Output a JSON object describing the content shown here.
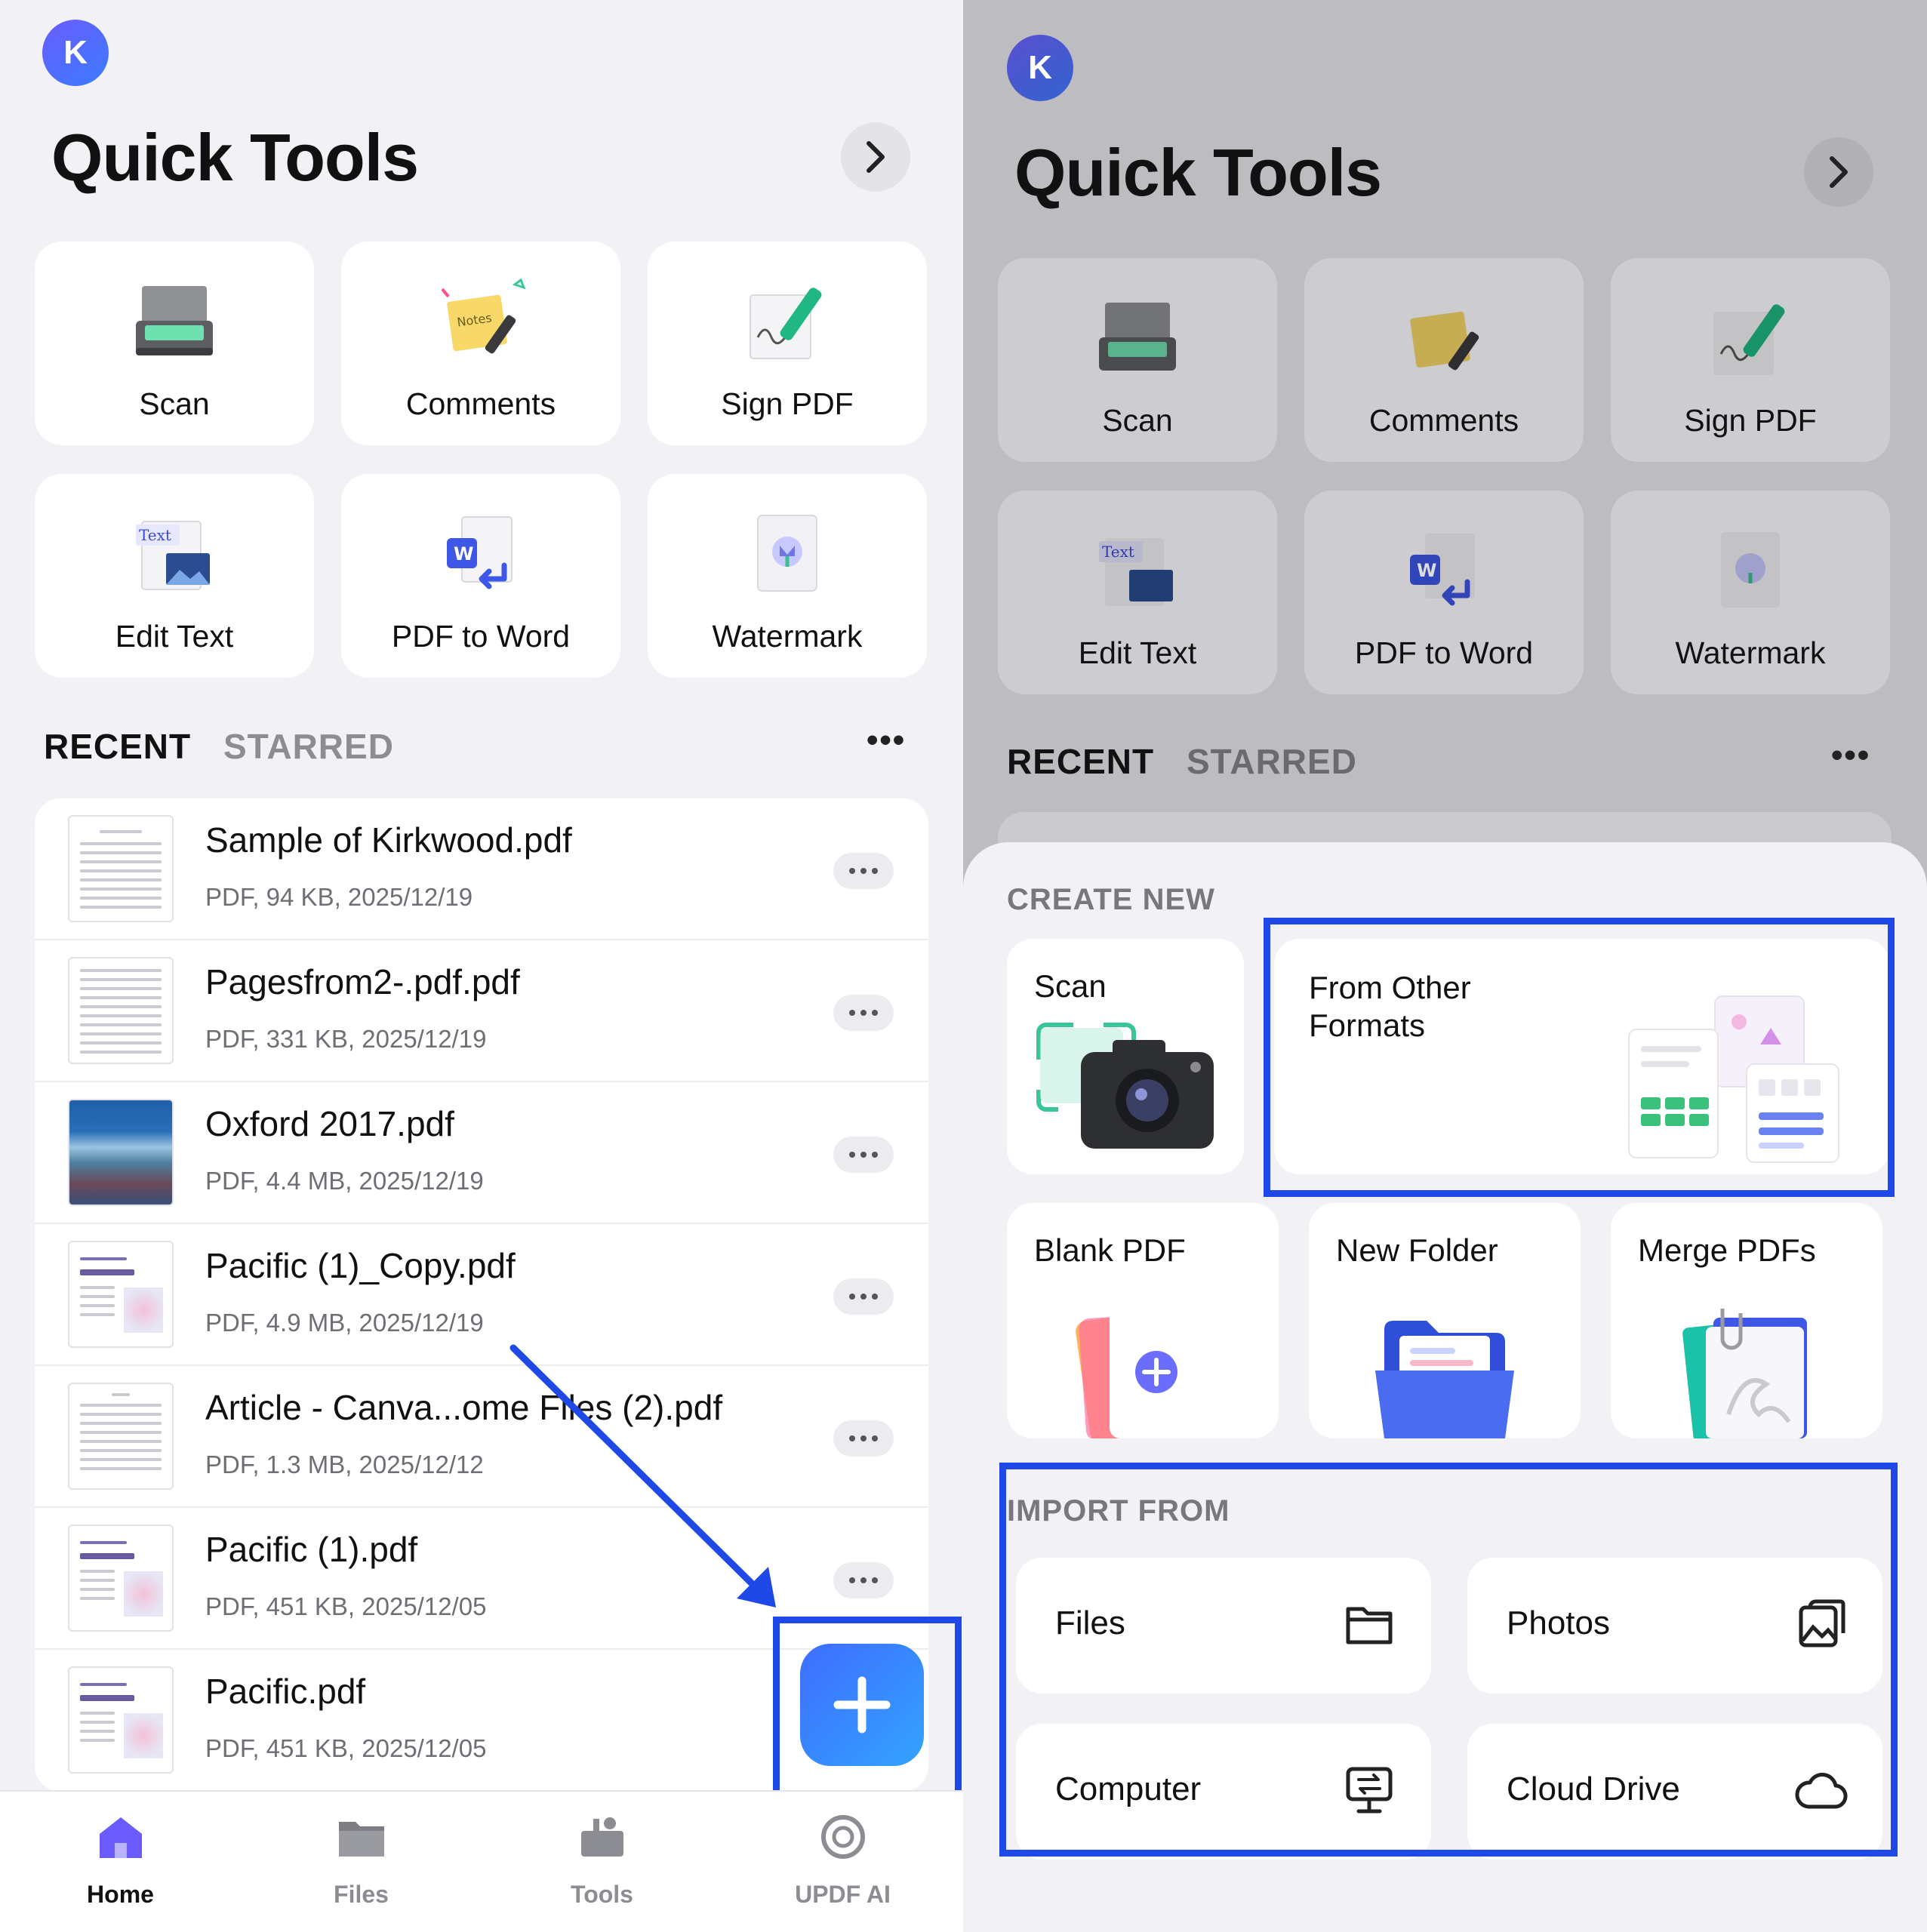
{
  "avatar_letter": "K",
  "title": "Quick Tools",
  "tools": [
    {
      "label": "Scan",
      "icon": "scanner-icon"
    },
    {
      "label": "Comments",
      "icon": "notes-icon"
    },
    {
      "label": "Sign PDF",
      "icon": "signature-pen-icon"
    },
    {
      "label": "Edit Text",
      "icon": "edit-text-icon"
    },
    {
      "label": "PDF to Word",
      "icon": "word-document-icon"
    },
    {
      "label": "Watermark",
      "icon": "watermark-icon"
    }
  ],
  "tabs": {
    "recent": "RECENT",
    "starred": "STARRED"
  },
  "files": [
    {
      "name": "Sample of Kirkwood.pdf",
      "meta": "PDF, 94 KB, 2025/12/19"
    },
    {
      "name": "Pagesfrom2-.pdf.pdf",
      "meta": "PDF, 331 KB, 2025/12/19"
    },
    {
      "name": "Oxford 2017.pdf",
      "meta": "PDF, 4.4 MB, 2025/12/19"
    },
    {
      "name": "Pacific (1)_Copy.pdf",
      "meta": "PDF, 4.9 MB, 2025/12/19"
    },
    {
      "name": " Article - Canva...ome Files (2).pdf",
      "meta": "PDF, 1.3 MB, 2025/12/12"
    },
    {
      "name": "Pacific (1).pdf",
      "meta": "PDF, 451 KB, 2025/12/05"
    },
    {
      "name": "Pacific.pdf",
      "meta": "PDF, 451 KB, 2025/12/05"
    }
  ],
  "tabbar": [
    {
      "label": "Home",
      "icon": "home-icon"
    },
    {
      "label": "Files",
      "icon": "folder-icon"
    },
    {
      "label": "Tools",
      "icon": "toolbox-icon"
    },
    {
      "label": "UPDF AI",
      "icon": "ai-icon"
    }
  ],
  "sheet": {
    "create_new": "CREATE NEW",
    "scan": "Scan",
    "from_other_formats": "From Other\nFormats",
    "blank_pdf": "Blank PDF",
    "new_folder": "New Folder",
    "merge_pdfs": "Merge PDFs",
    "import_from": "IMPORT FROM",
    "files": "Files",
    "photos": "Photos",
    "computer": "Computer",
    "cloud_drive": "Cloud Drive"
  },
  "colors": {
    "accent": "#1f49e6",
    "fab_start": "#3e6dff",
    "fab_end": "#33a3ff",
    "avatar": "#5b5cff"
  }
}
